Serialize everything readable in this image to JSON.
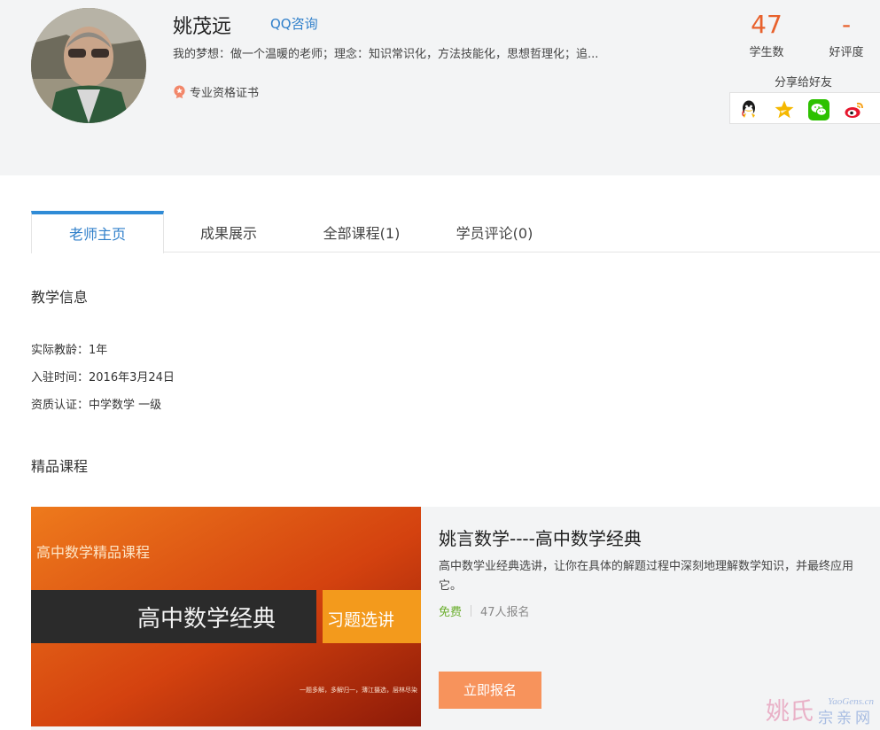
{
  "teacher": {
    "name": "姚茂远",
    "qq_link": "QQ咨询",
    "motto": "我的梦想：做一个温暖的老师；理念：知识常识化，方法技能化，思想哲理化；追...",
    "cert": "专业资格证书"
  },
  "stats": {
    "students_value": "47",
    "students_label": "学生数",
    "rating_value": "-",
    "rating_label": "好评度"
  },
  "share": {
    "label": "分享给好友",
    "icons": [
      "qq-icon",
      "qzone-star-icon",
      "wechat-icon",
      "weibo-icon"
    ]
  },
  "tabs": [
    {
      "label": "老师主页",
      "active": true
    },
    {
      "label": "成果展示",
      "active": false
    },
    {
      "label": "全部课程(1)",
      "active": false
    },
    {
      "label": "学员评论(0)",
      "active": false
    }
  ],
  "teaching_info": {
    "title": "教学信息",
    "lines": [
      "实际教龄：1年",
      "入驻时间：2016年3月24日",
      "资质认证：中学数学 一级"
    ]
  },
  "featured": {
    "title": "精品课程",
    "course": {
      "thumb_top_text": "高中数学精品课程",
      "thumb_main_text": "高中数学经典",
      "thumb_side_text": "习题选讲",
      "thumb_small_text": "一题多解，多解归一，薄江摄选，层林尽染",
      "title": "姚言数学----高中数学经典",
      "description": "高中数学业经典选讲，让你在具体的解题过程中深刻地理解数学知识，并最终应用它。",
      "price": "免费",
      "enrolled": "47人报名",
      "button": "立即报名"
    }
  },
  "watermark": {
    "text1": "姚氏",
    "text2": "YaoGens.cn",
    "text3": "宗亲网"
  },
  "colors": {
    "accent_blue": "#2f7fca",
    "stat_orange": "#e8612c",
    "free_green": "#6aae2d",
    "button_orange": "#f7935c",
    "header_bg": "#f3f4f5"
  }
}
